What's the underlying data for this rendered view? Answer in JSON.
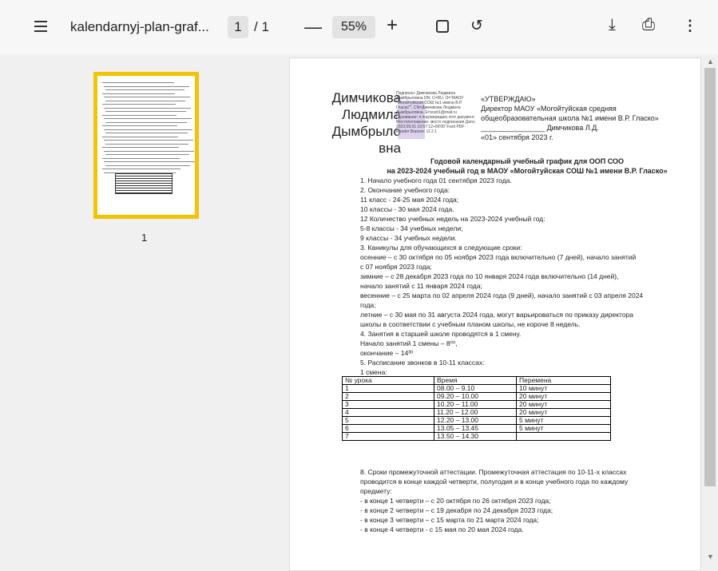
{
  "toolbar": {
    "file_name": "kalendarnyj-plan-graf...",
    "current_page": "1",
    "page_total": "/ 1",
    "zoom": "55%",
    "zoom_out": "—",
    "zoom_in": "+"
  },
  "sidebar": {
    "thumb_number": "1"
  },
  "doc": {
    "signature": [
      "Димчикова",
      "Людмила",
      "Дымбрыло",
      "вна"
    ],
    "stamp": "Подписан: Димчикова Людмила Дымбрыловна DN: C=RU, O=\"МАОУ \"Могойтуйская СОШ №1 имени В.Р. Гласко\"\", CN=Димчикова Людмила Дымбрыловна, E=sosh1@mail.ru Основание: я подтверждаю этот документ Местоположение: место подписания Дата: 2023.09.01 10:57:12+09'00' Foxit PDF Reader Версия: 11.2.1",
    "approve": [
      "«УТВЕРЖДАЮ»",
      "Директор МАОУ «Могойтуйская средняя",
      "общеобразовательная школа №1 имени В.Р. Гласко»",
      "________________ Димчикова Л.Д.",
      "«01» сентября 2023 г."
    ],
    "title1": "Годовой календарный учебный график для ООП СОО",
    "title2": "на 2023-2024 учебный год в МАОУ «Могойтуйская СОШ №1 имени В.Р. Гласко»",
    "lines": [
      "1.  Начало учебного года 01 сентября 2023 года.",
      "2.  Окончание учебного года:",
      "      11  класс - 24-25 мая 2024 года;",
      "      10  классы - 30 мая 2024 года.",
      "      12  Количество учебных недель на 2023-2024 учебный год:",
      "      5-8 классы - 34 учебных недели;",
      "      9    классы - 34 учебных недели.",
      "3.  Каникулы для обучающихся в следующие сроки:",
      "осенние – с 30 октября по 05 ноября 2023 года включительно  (7 дней), начало занятий",
      "с 07 ноября 2023 года;",
      "зимние – с 28 декабря 2023 года по 10 января 2024 года включительно (14 дней),",
      "начало занятий с 11 января 2024 года;",
      "весенние – с 25 марта по 02 апреля 2024 года (9 дней), начало занятий с 03 апреля 2024",
      "года;",
      "летние – с 30 мая по 31 августа 2024 года, могут варьироваться по приказу директора",
      "школы в соответствии с учебным планом школы, не короче 8 недель.",
      "4.  Занятия в старшей школе проводятся в 1 смену.",
      "      Начало занятий 1 смены – 8⁰⁰,",
      "      окончание – 14³⁰",
      "5.  Расписание звонков в 10-11 классах:",
      "      1 смена:"
    ],
    "table": {
      "header": [
        "№ урока",
        "Время",
        "Перемена"
      ],
      "rows": [
        [
          "1",
          "08.00 – 9.10",
          "10 минут"
        ],
        [
          "2",
          "09.20 – 10.00",
          "20 минут"
        ],
        [
          "3",
          "10.20 – 11.00",
          "20 минут"
        ],
        [
          "4",
          "11.20 – 12.00",
          "20 минут"
        ],
        [
          "5",
          "12.20 – 13.00",
          "5 минут"
        ],
        [
          "6",
          "13.05 – 13.45",
          "5 минут"
        ],
        [
          "7",
          "13.50 – 14.30",
          ""
        ]
      ]
    },
    "after": [
      "8.  Сроки промежуточной аттестации. Промежуточная аттестация по 10-11-х классах",
      "проводится в конце каждой четверти, полугодия и в конце учебного года по каждому",
      "предмету:",
      "- в конце 1 четверти – с 20 октября по 26 октября 2023 года;",
      "- в конце 2 четверти – с 19 декабря по 24 декабря 2023 года;",
      " - в конце 3 четверти – с  15 марта по 21 марта 2024 года;",
      "- в конце 4 четверти - с 15 мая  по 20 мая 2024 года."
    ]
  }
}
